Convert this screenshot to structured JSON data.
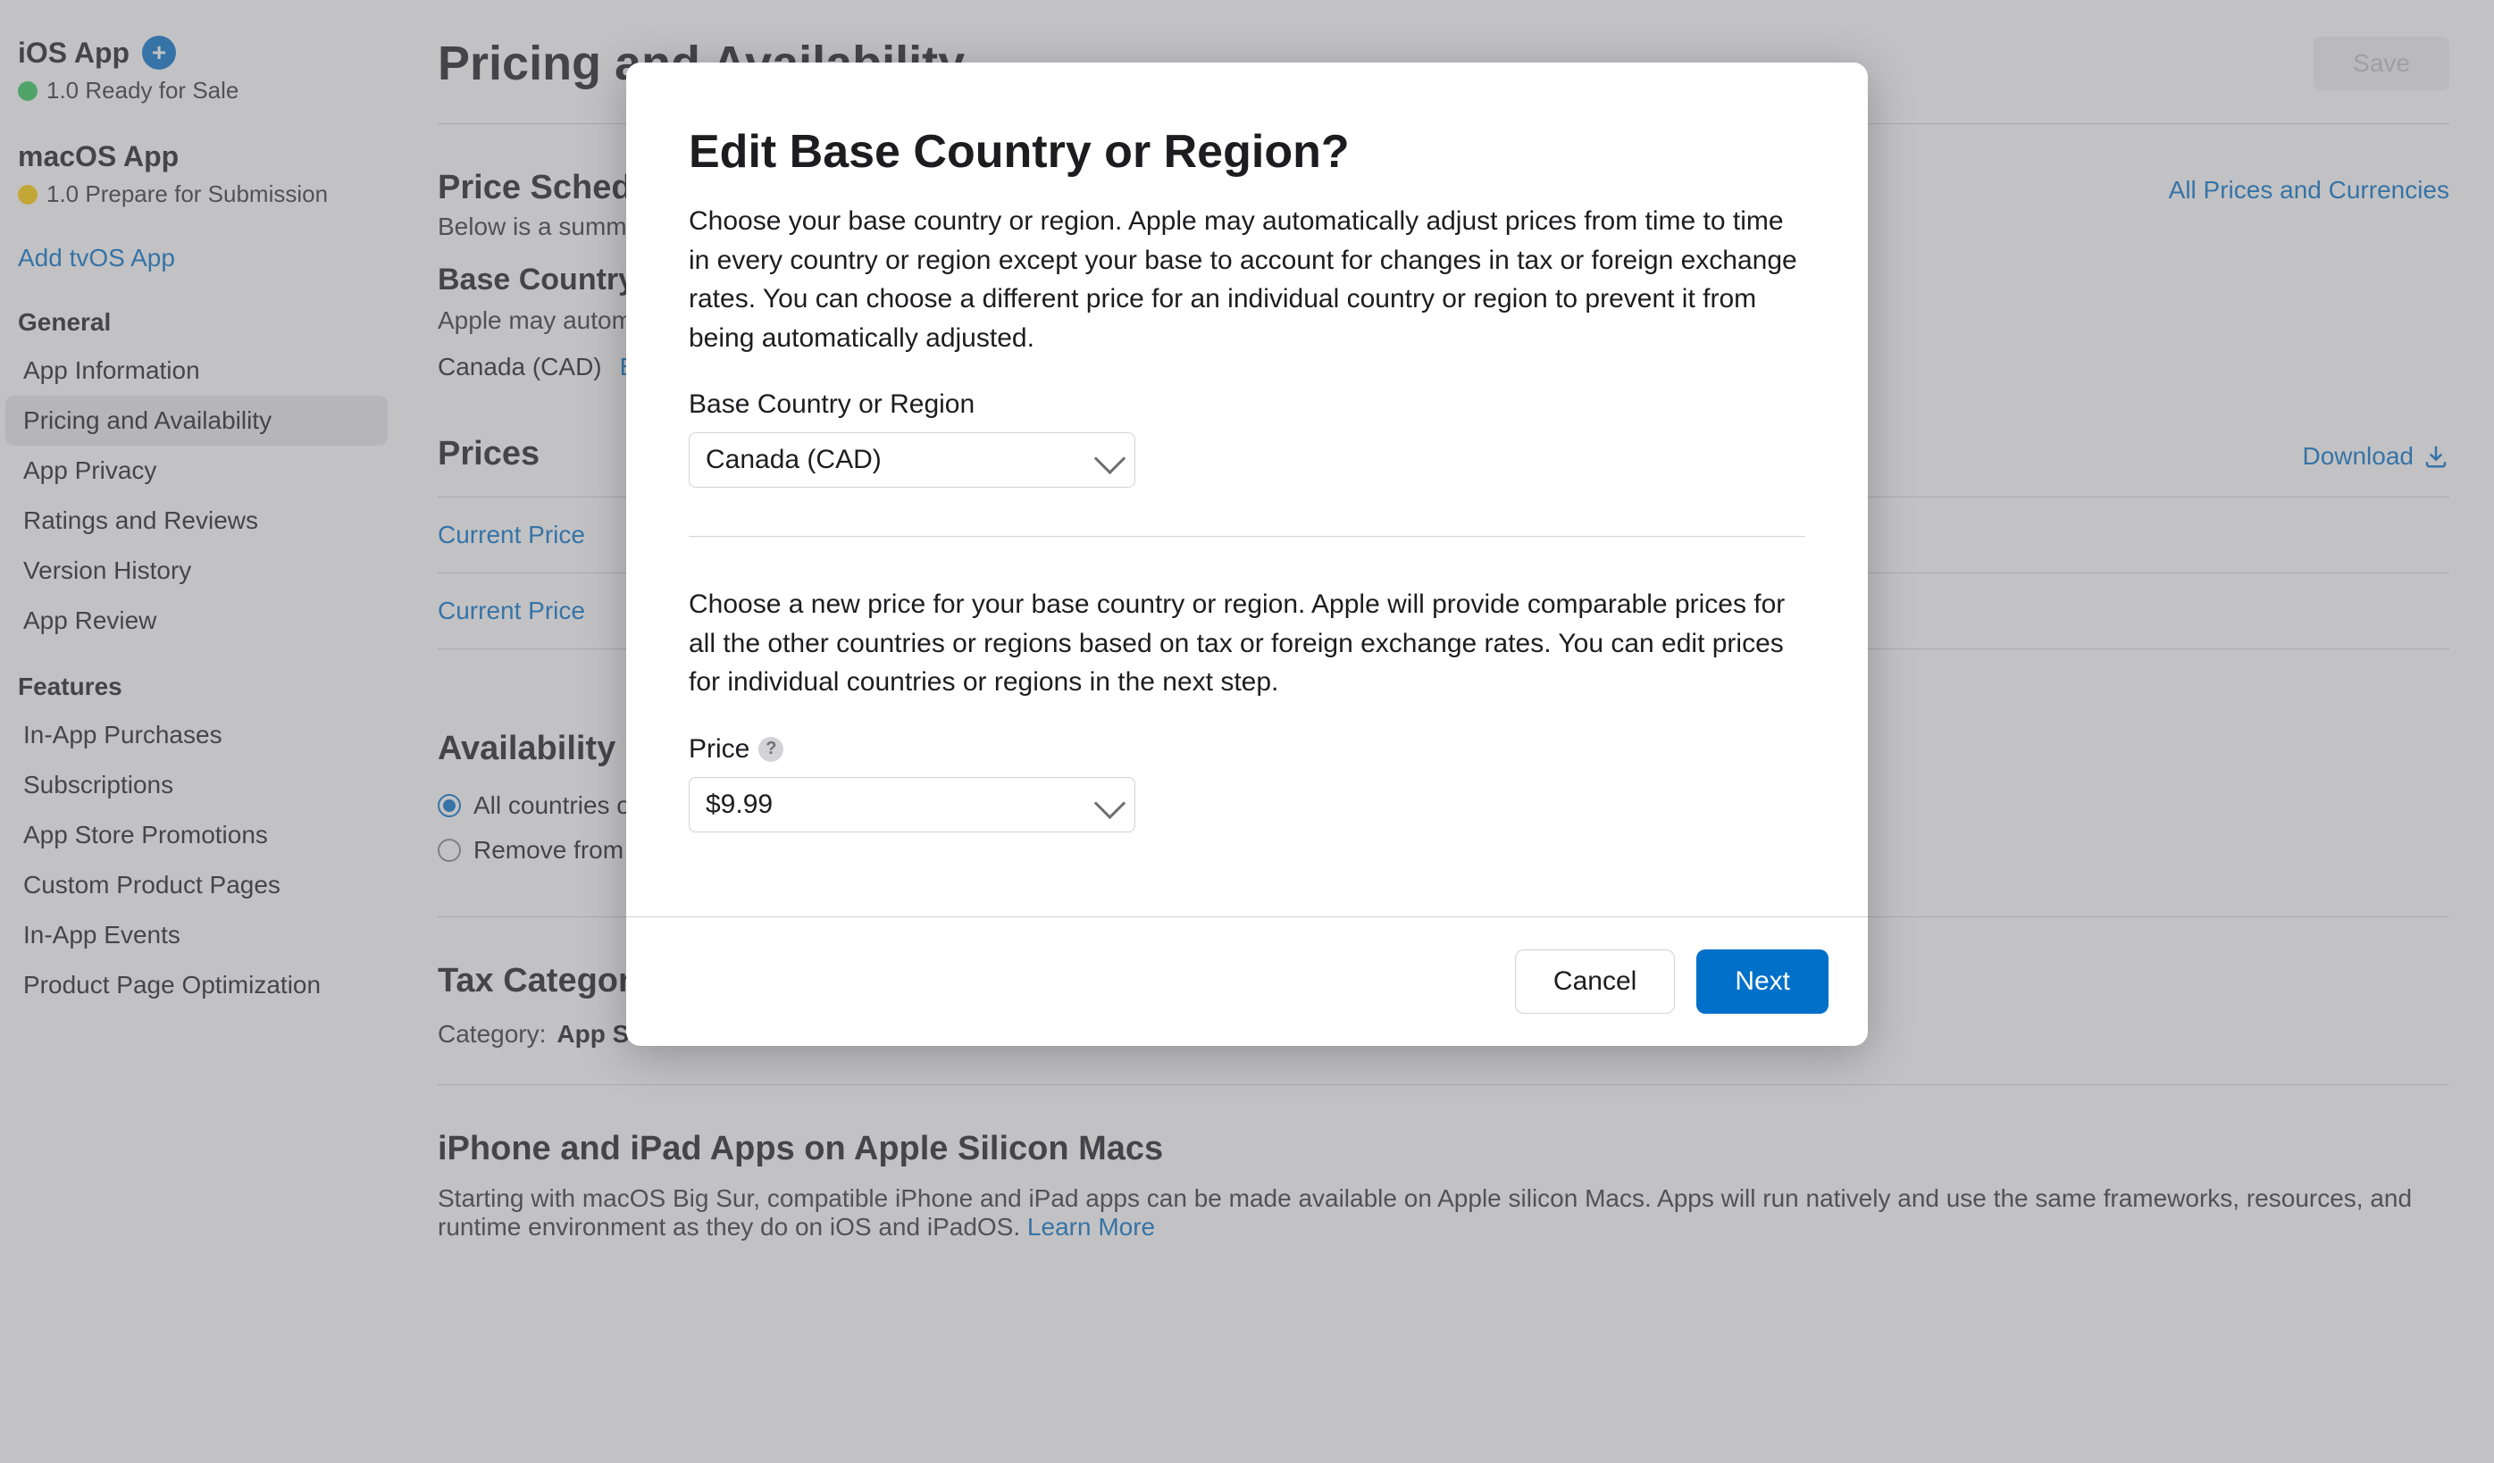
{
  "sidebar": {
    "ios": {
      "title": "iOS App",
      "status": "1.0 Ready for Sale"
    },
    "macos": {
      "title": "macOS App",
      "status": "1.0 Prepare for Submission"
    },
    "add_tvos": "Add tvOS App",
    "general": {
      "heading": "General",
      "items": [
        "App Information",
        "Pricing and Availability",
        "App Privacy",
        "Ratings and Reviews",
        "Version History",
        "App Review"
      ],
      "active_index": 1
    },
    "features": {
      "heading": "Features",
      "items": [
        "In-App Purchases",
        "Subscriptions",
        "App Store Promotions",
        "Custom Product Pages",
        "In-App Events",
        "Product Page Optimization"
      ]
    }
  },
  "main": {
    "title": "Pricing and Availability",
    "save": "Save",
    "price_schedule": {
      "heading": "Price Schedule",
      "link": "All Prices and Currencies",
      "desc_a": "Below is a summary of the price schedule for your app.",
      "base_heading": "Base Country or Region",
      "base_desc": "Apple may automatically adjust pricing in other regions based on this price and account for taxes and foreign exchange rates.",
      "base_value": "Canada (CAD)",
      "edit": "Edit"
    },
    "prices": {
      "heading": "Prices",
      "download": "Download",
      "rows": [
        "Current Price",
        "Current Price"
      ]
    },
    "availability": {
      "heading": "Availability",
      "opt_all": "All countries or regions selected",
      "opt_remove": "Remove from sale"
    },
    "tax": {
      "heading": "Tax Category",
      "label": "Category:",
      "value": "App Store software"
    },
    "silicon": {
      "heading": "iPhone and iPad Apps on Apple Silicon Macs",
      "desc": "Starting with macOS Big Sur, compatible iPhone and iPad apps can be made available on Apple silicon Macs. Apps will run natively and use the same frameworks, resources, and runtime environment as they do on iOS and iPadOS.",
      "learn": "Learn More"
    }
  },
  "modal": {
    "title": "Edit Base Country or Region?",
    "p1": "Choose your base country or region. Apple may automatically adjust prices from time to time in every country or region except your base to account for changes in tax or foreign exchange rates. You can choose a different price for an individual country or region to prevent it from being automatically adjusted.",
    "field1_label": "Base Country or Region",
    "field1_value": "Canada (CAD)",
    "p2": "Choose a new price for your base country or region. Apple will provide comparable prices for all the other countries or regions based on tax or foreign exchange rates. You can edit prices for individual countries or regions in the next step.",
    "field2_label": "Price",
    "field2_value": "$9.99",
    "cancel": "Cancel",
    "next": "Next"
  }
}
